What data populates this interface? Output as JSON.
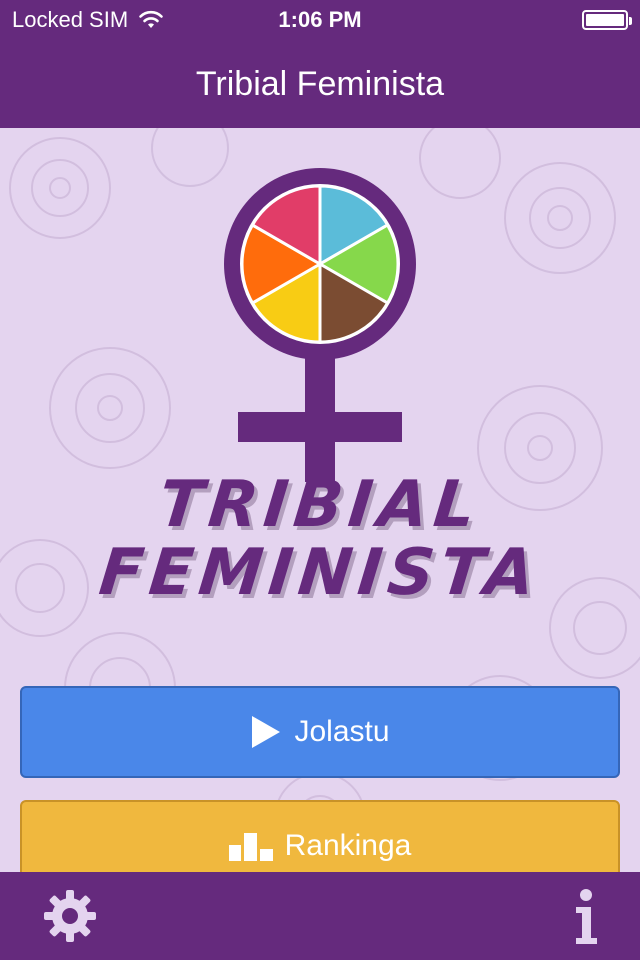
{
  "status_bar": {
    "carrier": "Locked SIM",
    "time": "1:06 PM",
    "icons": [
      "wifi-icon",
      "battery-icon"
    ]
  },
  "nav": {
    "title": "Tribial Feminista"
  },
  "logo": {
    "text_line1": "TRIBIAL",
    "text_line2": "FEMINISTA",
    "wedge_colors": [
      "#5bbcd9",
      "#86d84b",
      "#7b4c32",
      "#f8cc14",
      "#ff6c0c",
      "#e13d68"
    ]
  },
  "buttons": {
    "play": {
      "label": "Jolastu",
      "icon": "play-icon"
    },
    "ranking": {
      "label": "Rankinga",
      "icon": "bar-chart-icon"
    }
  },
  "toolbar": {
    "settings_icon": "gear-icon",
    "info_icon": "info-icon"
  },
  "colors": {
    "primary": "#652a7d",
    "background": "#e4d4ef",
    "play_button": "#4a87e9",
    "ranking_button": "#f0b83e"
  }
}
